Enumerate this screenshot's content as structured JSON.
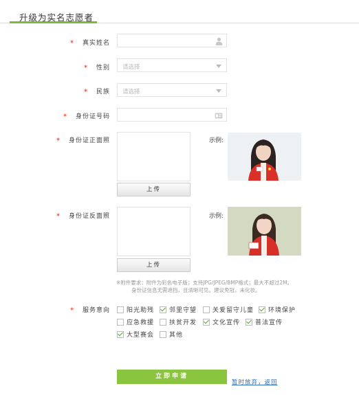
{
  "page": {
    "title": "升级为实名志愿者"
  },
  "form": {
    "required_mark": "*",
    "name_label": "真实姓名",
    "gender_label": "性别",
    "gender_placeholder": "请选择",
    "ethnicity_label": "民族",
    "ethnicity_placeholder": "请选择",
    "id_number_label": "身份证号码",
    "id_front_label": "身份证正面照",
    "id_back_label": "身份证反面照",
    "upload_label": "上传",
    "example_label": "示例:",
    "note_line1": "※附件要求：附件为彩色电子版；支持JPG/JPEG/BMP格式；最大不超过2M。",
    "note_line2": "身份证信息无需遮挡，且清晰可见。建议免冠，未化妆。",
    "service_label": "服务意向",
    "service_options": [
      {
        "label": "阳光助残",
        "checked": false
      },
      {
        "label": "邻里守望",
        "checked": true
      },
      {
        "label": "关爱留守儿童",
        "checked": false
      },
      {
        "label": "环境保护",
        "checked": true
      },
      {
        "label": "应急救援",
        "checked": false
      },
      {
        "label": "扶贫开发",
        "checked": false
      },
      {
        "label": "文化宣传",
        "checked": true
      },
      {
        "label": "普法宣传",
        "checked": true
      },
      {
        "label": "大型赛会",
        "checked": true
      },
      {
        "label": "其他",
        "checked": false
      }
    ]
  },
  "actions": {
    "submit_label": "立即申请",
    "later_link": "暂时放弃，返回"
  },
  "colors": {
    "accent": "#8bc43f",
    "required": "#e24a35",
    "link": "#2a6fc2"
  }
}
